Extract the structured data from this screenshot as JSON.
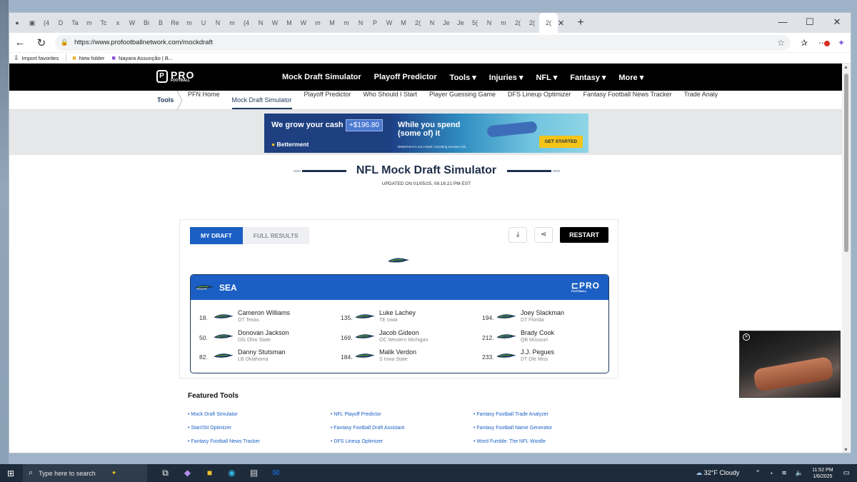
{
  "browser": {
    "tab_glyphs": [
      "(4",
      "D",
      "Ta",
      "m",
      "Tc",
      "x",
      "W",
      "Bi",
      "B",
      "Re",
      "m",
      "U",
      "N",
      "m",
      "(4",
      "N",
      "W",
      "M",
      "W",
      "m",
      "M",
      "m",
      "N",
      "P",
      "W",
      "M",
      "2(",
      "N",
      "Je",
      "Je",
      "5(",
      "N",
      "m",
      "2(",
      "2("
    ],
    "active_tab_glyph": "2(",
    "url": "https://www.profootballnetwork.com/mockdraft",
    "favorites": [
      {
        "icon": "import-icon",
        "label": "Import favorites"
      },
      {
        "icon": "folder-icon",
        "label": "New folder"
      },
      {
        "icon": "page-icon",
        "label": "Nayara Assunção | B..."
      }
    ]
  },
  "site": {
    "logo_text": "PRO",
    "logo_sub": "FOOTBALL",
    "nav": [
      "Mock Draft Simulator",
      "Playoff Predictor",
      "Tools ▾",
      "Injuries ▾",
      "NFL ▾",
      "Fantasy ▾",
      "More ▾"
    ],
    "subnav_root": "Tools",
    "subnav": [
      "PFN Home",
      "Mock Draft Simulator",
      "Playoff Predictor",
      "Who Should I Start",
      "Player Guessing Game",
      "DFS Lineup Optimizer",
      "Fantasy Football News Tracker",
      "Trade Analy"
    ],
    "subnav_active_index": 1
  },
  "ad": {
    "headline": "We grow your cash",
    "amount": "+$196.80",
    "brand": "Betterment",
    "tagline": "While you spend (some of) it",
    "fine_print": "Betterment is not a bank. Investing involves risk.",
    "cta": "GET STARTED"
  },
  "page": {
    "title": "NFL Mock Draft Simulator",
    "updated": "UPDATED ON 01/05/25, 08:16:21 PM EST"
  },
  "draft": {
    "tabs": [
      "MY DRAFT",
      "FULL RESULTS"
    ],
    "active_tab": 0,
    "restart_label": "RESTART",
    "team_abbr": "SEA",
    "picks": [
      {
        "num": "18.",
        "name": "Cameron Williams",
        "info": "OT Texas"
      },
      {
        "num": "50.",
        "name": "Donovan Jackson",
        "info": "OG Ohio State"
      },
      {
        "num": "82.",
        "name": "Danny Stutsman",
        "info": "LB Oklahoma"
      },
      {
        "num": "135.",
        "name": "Luke Lachey",
        "info": "TE Iowa"
      },
      {
        "num": "169.",
        "name": "Jacob Gideon",
        "info": "OC Western Michigan"
      },
      {
        "num": "184.",
        "name": "Malik Verdon",
        "info": "S Iowa State"
      },
      {
        "num": "194.",
        "name": "Joey Slackman",
        "info": "DT Florida"
      },
      {
        "num": "212.",
        "name": "Brady Cook",
        "info": "QB Missouri"
      },
      {
        "num": "233.",
        "name": "J.J. Pegues",
        "info": "DT Ole Miss"
      }
    ]
  },
  "featured": {
    "title": "Featured Tools",
    "links": [
      "Mock Draft Simulator",
      "NFL Playoff Predictor",
      "Fantasy Football Trade Analyzer",
      "Start/Sit Optimizer",
      "Fantasy Football Draft Assistant",
      "Fantasy Football Name Generator",
      "Fantasy Football News Tracker",
      "DFS Lineup Optimizer",
      "Word Fumble: The NFL Wordle"
    ]
  },
  "taskbar": {
    "search_placeholder": "Type here to search",
    "weather": "32°F  Cloudy",
    "time": "11:52 PM",
    "date": "1/6/2025"
  },
  "colors": {
    "accent_blue": "#1b5fc4",
    "navy": "#1e3a5c",
    "header_black": "#000000"
  }
}
